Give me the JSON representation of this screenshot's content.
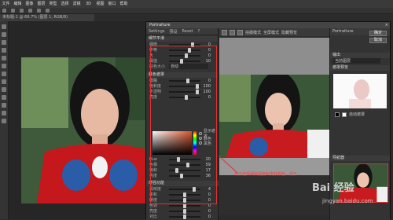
{
  "menubar": {
    "items": [
      "文件",
      "编辑",
      "图像",
      "图层",
      "类型",
      "选择",
      "滤镜",
      "3D",
      "视图",
      "窗口",
      "帮助"
    ]
  },
  "doc": {
    "tab_label": "未标题-1 @ 66.7% (图层 1, RGB/8)"
  },
  "portraiture": {
    "title": "Portraiture",
    "close": "×",
    "side_tabs": [
      "Settings",
      "预设",
      "Reset",
      "?"
    ],
    "sections": {
      "detail": "细节平滑",
      "skin": "肤色遮罩",
      "enhance": "增强功能"
    },
    "detail_rows": [
      {
        "label": "细微",
        "value": "0"
      },
      {
        "label": "中等",
        "value": "0"
      },
      {
        "label": "大",
        "value": "0"
      },
      {
        "label": "阈值",
        "value": "10"
      },
      {
        "label": "肤色大小",
        "value": "自动"
      }
    ],
    "skin_rows": [
      {
        "label": "模糊",
        "value": "0"
      },
      {
        "label": "饱和度",
        "value": "100"
      },
      {
        "label": "不透明",
        "value": "100"
      },
      {
        "label": "亮度",
        "value": "0"
      }
    ],
    "skin_mode": [
      "显示遮罩",
      "肤色",
      "黑色"
    ],
    "hsl_rows": [
      {
        "label": "Hue",
        "value": "20"
      },
      {
        "label": "色相",
        "value": "59"
      },
      {
        "label": "饱和",
        "value": "17"
      },
      {
        "label": "亮度",
        "value": "36"
      }
    ],
    "enhance_rows": [
      {
        "label": "清晰度",
        "value": "4"
      },
      {
        "label": "柔和",
        "value": "0"
      },
      {
        "label": "暖度",
        "value": "0"
      },
      {
        "label": "色调",
        "value": "0"
      },
      {
        "label": "亮度",
        "value": "0"
      },
      {
        "label": "对比",
        "value": "0"
      }
    ],
    "toolbar_labels": [
      "分屏",
      "并排显示",
      "拍摄模式",
      "全屏模式",
      "隐藏预览"
    ],
    "right": {
      "top_label": "Portraiture",
      "ok": "确定",
      "cancel": "取消",
      "output": "输出",
      "output_val": "当前图层",
      "mask_preview": "遮罩预览",
      "skin_label": "自动遮罩",
      "navigator": "导航器"
    },
    "annotation": "用于选择细致程度和皮肤颜色，便于…"
  },
  "watermark": {
    "logo": "Bai 经验",
    "url": "jingyan.baidu.com"
  },
  "colors": {
    "annotation": "#e03030",
    "panel": "#333333",
    "title": "#454545"
  }
}
